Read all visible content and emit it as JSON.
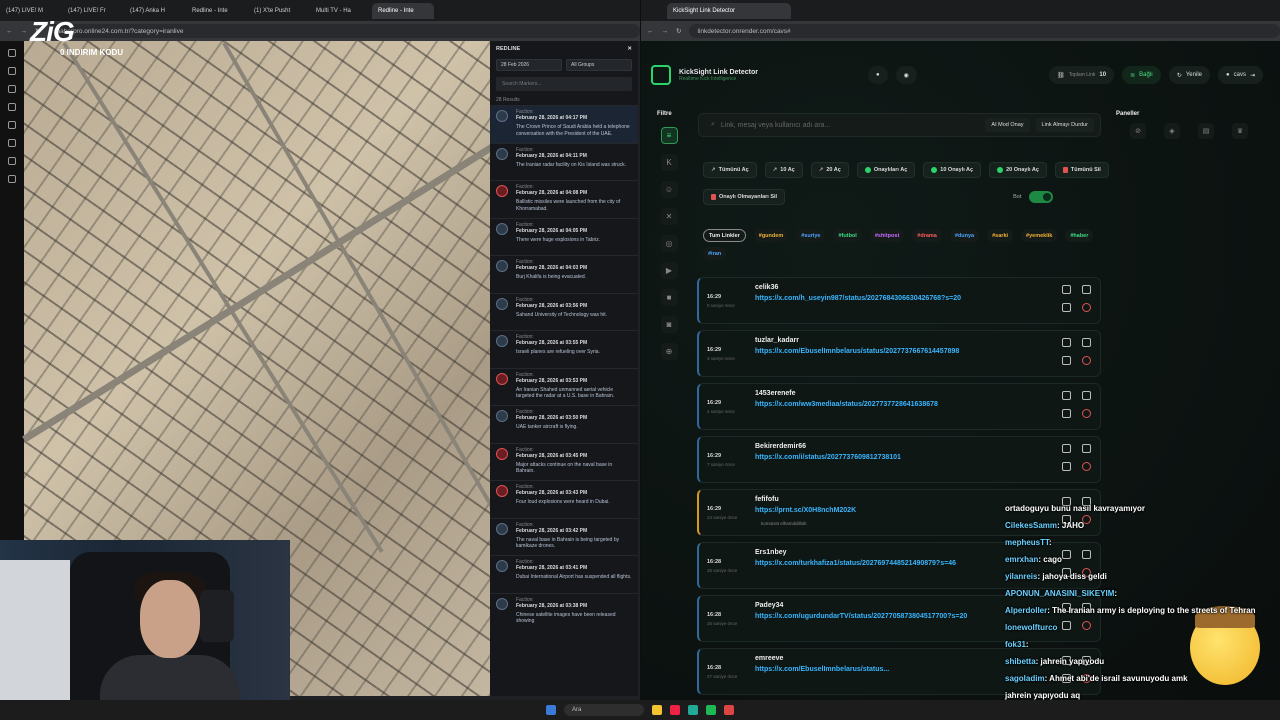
{
  "left_browser": {
    "tabs": [
      "(147) LIVE! M",
      "(147) LIVE! Fr",
      "(147) Anka H",
      "Redline - Inte",
      "(1) X'te Pusht",
      "Multi TV - Ha",
      "Redline - Inte"
    ],
    "url": "haberpro.online24.com.tr/?category=iranlive",
    "stream_logo": "ZiG",
    "stream_sub": "0 INDIRIM KODU",
    "panel": {
      "title": "REDLINE",
      "date": "28 Feb 2026",
      "group": "All Groups",
      "search_placeholder": "Search Markers...",
      "results": "28 Results",
      "items": [
        {
          "faction": "Faction:",
          "date": "February 28, 2026 at 04:17 PM",
          "text": "The Crown Prince of Saudi Arabia held a telephone conversation with the President of the UAE.",
          "red": false
        },
        {
          "faction": "Faction:",
          "date": "February 28, 2026 at 04:11 PM",
          "text": "The Iranian radar facility on Kis Island was struck.",
          "red": false
        },
        {
          "faction": "Faction:",
          "date": "February 28, 2026 at 04:08 PM",
          "text": "Ballistic missiles were launched from the city of Khorramabad.",
          "red": true
        },
        {
          "faction": "Faction:",
          "date": "February 28, 2026 at 04:05 PM",
          "text": "There were huge explosions in Tabriz.",
          "red": false
        },
        {
          "faction": "Faction:",
          "date": "February 28, 2026 at 04:03 PM",
          "text": "Burj Khalifa is being evacuated.",
          "red": false
        },
        {
          "faction": "Faction:",
          "date": "February 28, 2026 at 03:56 PM",
          "text": "Sahand University of Technology was hit.",
          "red": false
        },
        {
          "faction": "Faction:",
          "date": "February 28, 2026 at 03:55 PM",
          "text": "Israeli planes are refueling over Syria.",
          "red": false
        },
        {
          "faction": "Faction:",
          "date": "February 28, 2026 at 03:53 PM",
          "text": "An Iranian Shahed unmanned aerial vehicle targeted the radar at a U.S. base in Bahrain.",
          "red": true
        },
        {
          "faction": "Faction:",
          "date": "February 28, 2026 at 03:50 PM",
          "text": "UAE tanker aircraft is flying.",
          "red": false
        },
        {
          "faction": "Faction:",
          "date": "February 28, 2026 at 03:45 PM",
          "text": "Major attacks continue on the naval base in Bahrain.",
          "red": true
        },
        {
          "faction": "Faction:",
          "date": "February 28, 2026 at 03:43 PM",
          "text": "Four loud explosions were heard in Dubai.",
          "red": true
        },
        {
          "faction": "Faction:",
          "date": "February 28, 2026 at 03:42 PM",
          "text": "The naval base in Bahrain is being targeted by kamikaze drones.",
          "red": false
        },
        {
          "faction": "Faction:",
          "date": "February 28, 2026 at 03:41 PM",
          "text": "Dubai International Airport has suspended all flights.",
          "red": false
        },
        {
          "faction": "Faction:",
          "date": "February 28, 2026 at 03:38 PM",
          "text": "Chinese satellite images have been released showing",
          "red": false
        }
      ]
    }
  },
  "right_browser": {
    "tab": "KickSight Link Detector",
    "url": "linkdetector.onrender.com/cavs#",
    "app_title": "KickSight Link Detector",
    "app_sub": "Realtime Kick Intelligence",
    "total_label": "Toplam Link",
    "total": "10",
    "connected": "Bağlı",
    "refresh": "Yenile",
    "user": "cavs",
    "filter_label": "Filtre",
    "search_placeholder": "Link, mesaj veya kullanıcı adı ara...",
    "ai_btn": "AI Mod Onay",
    "stop_btn": "Link Almayı Durdur",
    "panels_label": "Paneller",
    "buttons": [
      "Tümünü Aç",
      "10 Aç",
      "20 Aç",
      "Onaylıları Aç",
      "10 Onaylı Aç",
      "20 Onaylı Aç",
      "Tümünü Sil"
    ],
    "delete_unapproved": "Onaylı Olmayanları Sil",
    "bot": "Bot",
    "tags": [
      "Tum Linkler",
      "#gundem",
      "#suriye",
      "#futbol",
      "#shitpost",
      "#drama",
      "#dunya",
      "#sarki",
      "#yemeklik",
      "#haber",
      "#iran"
    ],
    "cards": [
      {
        "time": "16:29",
        "ago": "0 saniye önce",
        "user": "celik36",
        "link": "https://x.com/h_useyin987/status/2027684306630426768?s=20",
        "note": "",
        "y": false
      },
      {
        "time": "16:29",
        "ago": "3 saniye önce",
        "user": "tuzlar_kadarr",
        "link": "https://x.com/EbuselImnbelarus/status/2027737667614457898",
        "note": "",
        "y": false
      },
      {
        "time": "16:29",
        "ago": "4 saniye önce",
        "user": "1453erenefe",
        "link": "https://x.com/ww3mediaa/status/2027737728641638678",
        "note": "",
        "y": false
      },
      {
        "time": "16:29",
        "ago": "7 saniye önce",
        "user": "Bekirerdemir66",
        "link": "https://x.com/i/status/2027737609812738101",
        "note": "",
        "y": false
      },
      {
        "time": "16:29",
        "ago": "24 saniye önce",
        "user": "fefifofu",
        "link": "https://prnt.sc/X0H8nchM202K",
        "note": "komünist elhamdülillah",
        "y": true
      },
      {
        "time": "16:28",
        "ago": "25 saniye önce",
        "user": "Ers1nbey",
        "link": "https://x.com/turkhafiza1/status/2027697448521490879?s=46",
        "note": "",
        "y": false
      },
      {
        "time": "16:28",
        "ago": "25 saniye önce",
        "user": "Padey34",
        "link": "https://x.com/ugurdundarTV/status/2027705873804517700?s=20",
        "note": "",
        "y": false
      },
      {
        "time": "16:28",
        "ago": "27 saniye önce",
        "user": "emreeve",
        "link": "https://x.com/EbuselImnbelarus/status...",
        "note": "",
        "y": false
      }
    ]
  },
  "chat": [
    {
      "n": "",
      "m": "ortadoguyu bunu nasıl kavrayamıyor"
    },
    {
      "n": "CilekesSamm",
      "m": ": JAHO"
    },
    {
      "n": "mepheusTT",
      "m": ":"
    },
    {
      "n": "emrxhan",
      "m": ": cago"
    },
    {
      "n": "yilanreis",
      "m": ": jahoya diss geldi"
    },
    {
      "n": "APONUN_ANASINI_SIKEYIM",
      "m": ":"
    },
    {
      "n": "Alperdoller",
      "m": ": The Iranian army is deploying to the streets of Tehran"
    },
    {
      "n": "lonewolfturco",
      "m": ""
    },
    {
      "n": "fok31",
      "m": ":"
    },
    {
      "n": "shibetta",
      "m": ": jahrein yapıyodu"
    },
    {
      "n": "sagoladim",
      "m": ": Ahmet abi'de israil savunuyodu amk"
    },
    {
      "n": "",
      "m": "jahrein yapıyodu aq"
    }
  ],
  "taskbar": {
    "search": "Ara"
  }
}
